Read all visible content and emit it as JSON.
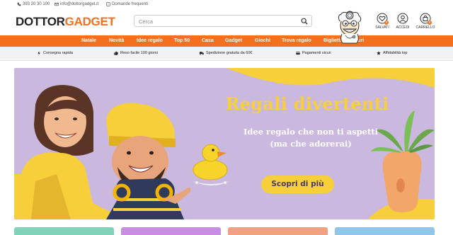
{
  "topbar": {
    "phone": "393 20 30 100",
    "email": "info@dottorgadget.it",
    "faq": "Domande frequenti"
  },
  "logo": {
    "part1": "DOTTOR",
    "part2": "GADGET"
  },
  "search": {
    "placeholder": "Cerca",
    "value": ""
  },
  "actions": {
    "saved": "SALVATI",
    "saved_count": "0",
    "login": "ACCEDI",
    "cart": "CARRELLO",
    "cart_count": "0"
  },
  "nav": [
    "Natale",
    "Novità",
    "Idee regalo",
    "Top 50",
    "Casa",
    "Gadget",
    "Giochi",
    "Trova regalo",
    "Biglietti di auguri"
  ],
  "usp": [
    {
      "icon": "lightning-icon",
      "label": "Consegna rapida"
    },
    {
      "icon": "thumbs-up-icon",
      "label": "Reso facile 100 giorni"
    },
    {
      "icon": "truck-icon",
      "label": "Spedizione gratuita da 60€"
    },
    {
      "icon": "card-icon",
      "label": "Pagamenti sicuri"
    },
    {
      "icon": "star-icon",
      "label": "Affidabilità top"
    }
  ],
  "hero": {
    "title": "Regali divertenti",
    "subtitle_line1": "Idee regalo che non ti aspetti",
    "subtitle_line2": "(ma che adorerai)",
    "cta": "Scopri di più"
  },
  "colors": {
    "brand": "#f37021",
    "hero_bg": "#cbb8df",
    "hero_yellow": "#f6cf3a",
    "card_colors": [
      "#7fd3b8",
      "#c98de6",
      "#f3a083",
      "#8fc6ea"
    ]
  }
}
